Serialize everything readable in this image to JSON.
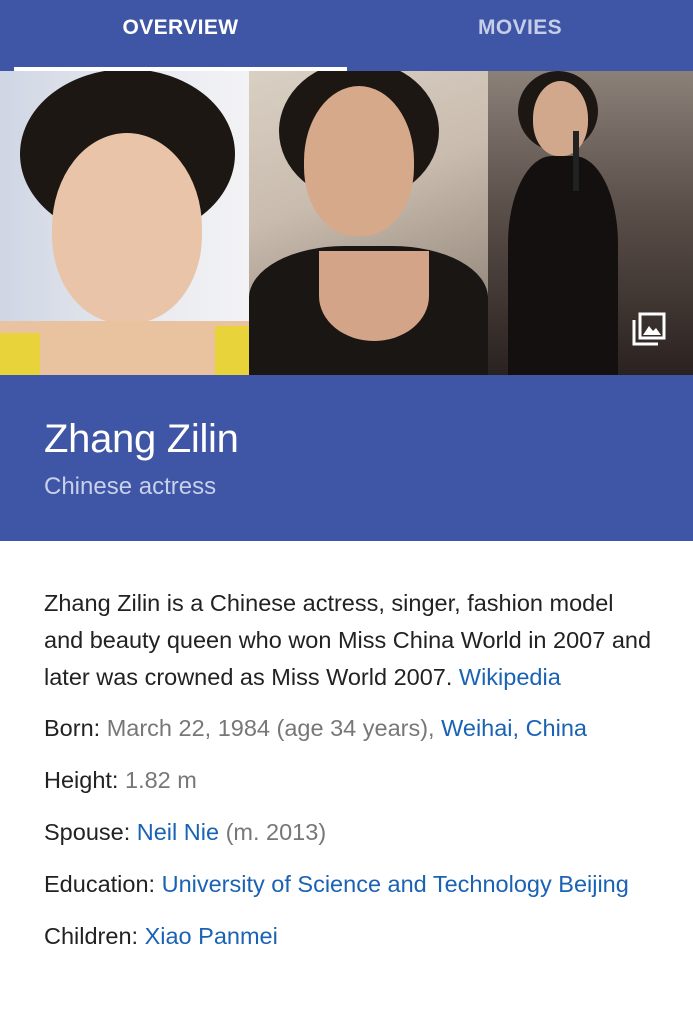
{
  "tabs": [
    {
      "label": "OVERVIEW",
      "active": true
    },
    {
      "label": "MOVIES",
      "active": false
    }
  ],
  "header": {
    "title": "Zhang Zilin",
    "subtitle": "Chinese actress"
  },
  "description": {
    "text": "Zhang Zilin is a Chinese actress, singer, fashion model and beauty queen who won Miss China World in 2007 and later was crowned as Miss World 2007.",
    "source_link": "Wikipedia"
  },
  "facts": {
    "born": {
      "label": "Born:",
      "value": "March 22, 1984 (age 34 years),",
      "link": "Weihai, China"
    },
    "height": {
      "label": "Height:",
      "value": "1.82 m"
    },
    "spouse": {
      "label": "Spouse:",
      "link": "Neil Nie",
      "value": "(m. 2013)"
    },
    "education": {
      "label": "Education:",
      "link": "University of Science and Technology Beijing"
    },
    "children": {
      "label": "Children:",
      "link": "Xiao Panmei"
    }
  },
  "icons": {
    "gallery": "image-gallery-icon"
  },
  "colors": {
    "header_bg": "#3f55a5",
    "link": "#1a62b4",
    "muted": "#777777"
  }
}
